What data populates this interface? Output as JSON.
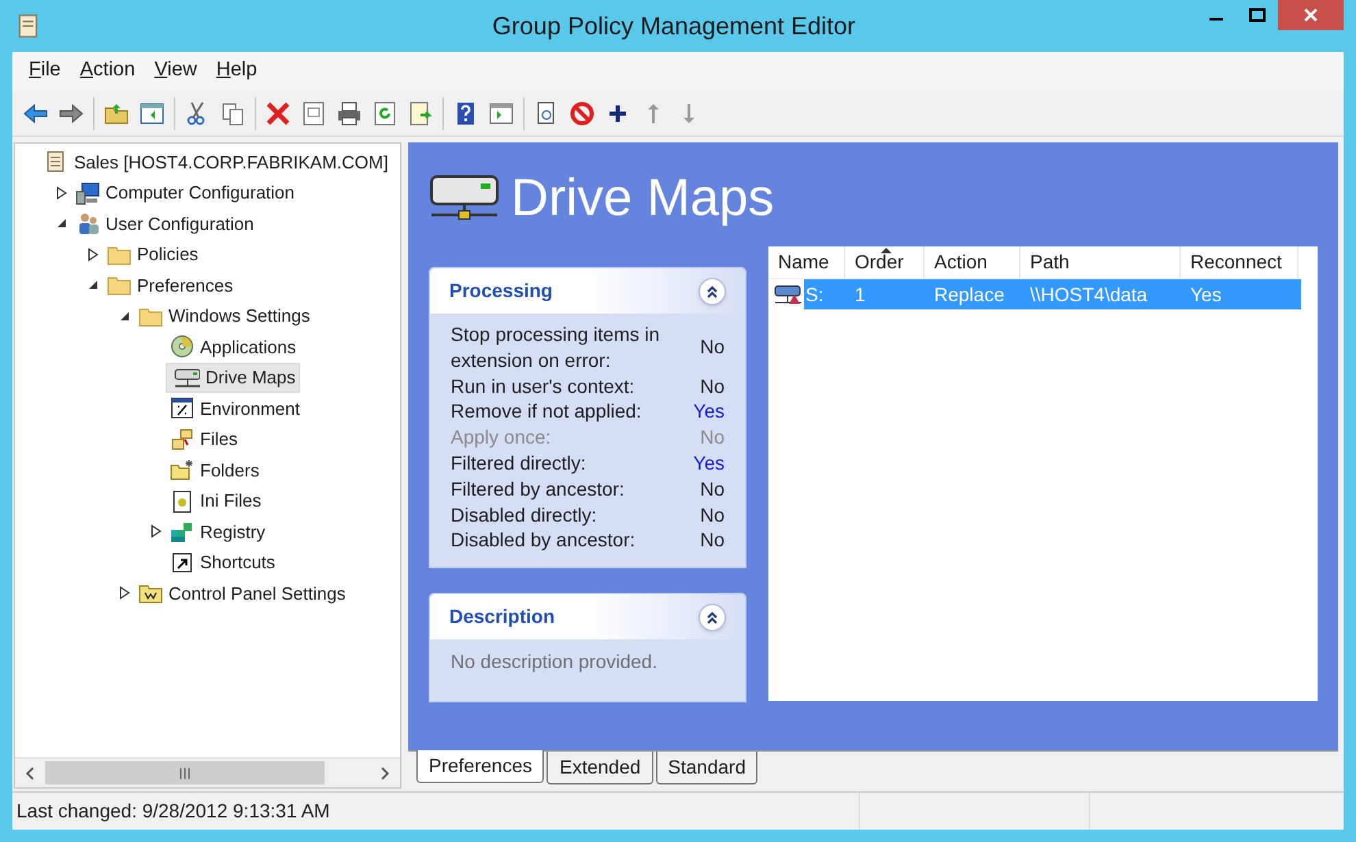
{
  "window": {
    "title": "Group Policy Management Editor"
  },
  "menu": [
    {
      "label": "File",
      "mnemonic_underlined": true
    },
    {
      "label": "Action",
      "mnemonic_underlined": true
    },
    {
      "label": "View",
      "mnemonic_underlined": true
    },
    {
      "label": "Help",
      "mnemonic_underlined": true
    }
  ],
  "tree": [
    {
      "label": "Sales [HOST4.CORP.FABRIKAM.COM]",
      "kind": "root",
      "selected": false,
      "children": [
        {
          "label": "Computer Configuration",
          "kind": "computer",
          "selected": false,
          "expanded": false
        },
        {
          "label": "User Configuration",
          "kind": "user",
          "selected": false,
          "expanded": true,
          "children": [
            {
              "label": "Policies",
              "kind": "folder",
              "selected": false,
              "expanded": false
            },
            {
              "label": "Preferences",
              "kind": "folder",
              "selected": false,
              "expanded": true,
              "children": [
                {
                  "label": "Windows Settings",
                  "kind": "folder",
                  "selected": false,
                  "expanded": true,
                  "children": [
                    {
                      "label": "Applications",
                      "kind": "disc",
                      "selected": false
                    },
                    {
                      "label": "Drive Maps",
                      "kind": "drive",
                      "selected": true
                    },
                    {
                      "label": "Environment",
                      "kind": "percent",
                      "selected": false
                    },
                    {
                      "label": "Files",
                      "kind": "files",
                      "selected": false
                    },
                    {
                      "label": "Folders",
                      "kind": "sparkfolder",
                      "selected": false
                    },
                    {
                      "label": "Ini Files",
                      "kind": "notepad",
                      "selected": false
                    },
                    {
                      "label": "Registry",
                      "kind": "registry",
                      "selected": false,
                      "expanded": false
                    },
                    {
                      "label": "Shortcuts",
                      "kind": "shortcut",
                      "selected": false
                    }
                  ]
                },
                {
                  "label": "Control Panel Settings",
                  "kind": "panelfolder",
                  "selected": false,
                  "expanded": false
                }
              ]
            }
          ]
        }
      ]
    }
  ],
  "heading": "Drive Maps",
  "processing": {
    "title": "Processing",
    "expanded": true,
    "rows": [
      {
        "label": "Stop processing items in extension on error:",
        "value": "No",
        "disabled": false,
        "highlighted": false
      },
      {
        "label": "Run in user's context:",
        "value": "No",
        "disabled": false,
        "highlighted": false
      },
      {
        "label": "Remove if not applied:",
        "value": "Yes",
        "disabled": false,
        "highlighted": true
      },
      {
        "label": "Apply once:",
        "value": "No",
        "disabled": true,
        "highlighted": false
      },
      {
        "label": "Filtered directly:",
        "value": "Yes",
        "disabled": false,
        "highlighted": true
      },
      {
        "label": "Filtered by ancestor:",
        "value": "No",
        "disabled": false,
        "highlighted": false
      },
      {
        "label": "Disabled directly:",
        "value": "No",
        "disabled": false,
        "highlighted": false
      },
      {
        "label": "Disabled by ancestor:",
        "value": "No",
        "disabled": false,
        "highlighted": false
      }
    ]
  },
  "description": {
    "title": "Description",
    "expanded": true,
    "text": "No description provided."
  },
  "table": {
    "columns": [
      {
        "label": "Name",
        "sorted": false
      },
      {
        "label": "Order",
        "sorted": true
      },
      {
        "label": "Action",
        "sorted": false
      },
      {
        "label": "Path",
        "sorted": false
      },
      {
        "label": "Reconnect",
        "sorted": false
      }
    ],
    "rows": [
      {
        "cells": [
          "S:",
          "1",
          "Replace",
          "\\\\HOST4\\data",
          "Yes"
        ],
        "selected": true
      }
    ]
  },
  "tabs": [
    {
      "label": "Preferences",
      "selected": true
    },
    {
      "label": "Extended",
      "selected": false
    },
    {
      "label": "Standard",
      "selected": false
    }
  ],
  "status_bar": "Last changed: 9/28/2012 9:13:31 AM"
}
